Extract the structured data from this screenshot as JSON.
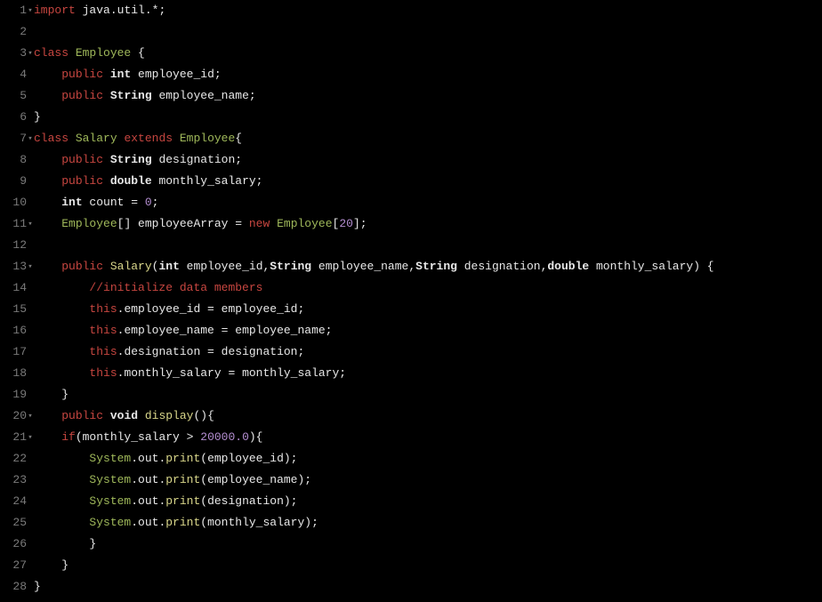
{
  "lines": [
    {
      "num": "1",
      "fold": true,
      "tokens": [
        {
          "t": "import",
          "c": "kw-red"
        },
        {
          "t": " "
        },
        {
          "t": "java",
          "c": "ident"
        },
        {
          "t": "."
        },
        {
          "t": "util",
          "c": "ident"
        },
        {
          "t": ".*;"
        }
      ]
    },
    {
      "num": "2",
      "fold": false,
      "tokens": []
    },
    {
      "num": "3",
      "fold": true,
      "tokens": [
        {
          "t": "class",
          "c": "kw-red"
        },
        {
          "t": " "
        },
        {
          "t": "Employee",
          "c": "class-name"
        },
        {
          "t": " {"
        }
      ]
    },
    {
      "num": "4",
      "fold": false,
      "tokens": [
        {
          "t": "    "
        },
        {
          "t": "public",
          "c": "kw-red"
        },
        {
          "t": " "
        },
        {
          "t": "int",
          "c": "kw-type"
        },
        {
          "t": " employee_id;"
        }
      ]
    },
    {
      "num": "5",
      "fold": false,
      "tokens": [
        {
          "t": "    "
        },
        {
          "t": "public",
          "c": "kw-red"
        },
        {
          "t": " "
        },
        {
          "t": "String",
          "c": "kw-type"
        },
        {
          "t": " employee_name;"
        }
      ]
    },
    {
      "num": "6",
      "fold": false,
      "tokens": [
        {
          "t": "}"
        }
      ]
    },
    {
      "num": "7",
      "fold": true,
      "tokens": [
        {
          "t": "class",
          "c": "kw-red"
        },
        {
          "t": " "
        },
        {
          "t": "Salary",
          "c": "class-name"
        },
        {
          "t": " "
        },
        {
          "t": "extends",
          "c": "kw-red"
        },
        {
          "t": " "
        },
        {
          "t": "Employee",
          "c": "class-name"
        },
        {
          "t": "{"
        }
      ]
    },
    {
      "num": "8",
      "fold": false,
      "tokens": [
        {
          "t": "    "
        },
        {
          "t": "public",
          "c": "kw-red"
        },
        {
          "t": " "
        },
        {
          "t": "String",
          "c": "kw-type"
        },
        {
          "t": " designation;"
        }
      ]
    },
    {
      "num": "9",
      "fold": false,
      "tokens": [
        {
          "t": "    "
        },
        {
          "t": "public",
          "c": "kw-red"
        },
        {
          "t": " "
        },
        {
          "t": "double",
          "c": "kw-type"
        },
        {
          "t": " monthly_salary;"
        }
      ]
    },
    {
      "num": "10",
      "fold": false,
      "tokens": [
        {
          "t": "    "
        },
        {
          "t": "int",
          "c": "kw-type"
        },
        {
          "t": " count = "
        },
        {
          "t": "0",
          "c": "num"
        },
        {
          "t": ";"
        }
      ]
    },
    {
      "num": "11",
      "fold": true,
      "tokens": [
        {
          "t": "    "
        },
        {
          "t": "Employee",
          "c": "class-name"
        },
        {
          "t": "[] employeeArray = "
        },
        {
          "t": "new",
          "c": "new-kw"
        },
        {
          "t": " "
        },
        {
          "t": "Employee",
          "c": "class-name"
        },
        {
          "t": "["
        },
        {
          "t": "20",
          "c": "num"
        },
        {
          "t": "];"
        }
      ]
    },
    {
      "num": "12",
      "fold": false,
      "tokens": []
    },
    {
      "num": "13",
      "fold": true,
      "tokens": [
        {
          "t": "    "
        },
        {
          "t": "public",
          "c": "kw-red"
        },
        {
          "t": " "
        },
        {
          "t": "Salary",
          "c": "method-name"
        },
        {
          "t": "("
        },
        {
          "t": "int",
          "c": "kw-type"
        },
        {
          "t": " employee_id,"
        },
        {
          "t": "String",
          "c": "kw-type"
        },
        {
          "t": " employee_name,"
        },
        {
          "t": "String",
          "c": "kw-type"
        },
        {
          "t": " designation,"
        },
        {
          "t": "double",
          "c": "kw-type"
        },
        {
          "t": " monthly_salary) {"
        }
      ]
    },
    {
      "num": "14",
      "fold": false,
      "tokens": [
        {
          "t": "        "
        },
        {
          "t": "//initialize data members",
          "c": "comment"
        }
      ]
    },
    {
      "num": "15",
      "fold": false,
      "tokens": [
        {
          "t": "        "
        },
        {
          "t": "this",
          "c": "this-kw"
        },
        {
          "t": ".employee_id = employee_id;"
        }
      ]
    },
    {
      "num": "16",
      "fold": false,
      "tokens": [
        {
          "t": "        "
        },
        {
          "t": "this",
          "c": "this-kw"
        },
        {
          "t": ".employee_name = employee_name;"
        }
      ]
    },
    {
      "num": "17",
      "fold": false,
      "tokens": [
        {
          "t": "        "
        },
        {
          "t": "this",
          "c": "this-kw"
        },
        {
          "t": ".designation = designation;"
        }
      ]
    },
    {
      "num": "18",
      "fold": false,
      "tokens": [
        {
          "t": "        "
        },
        {
          "t": "this",
          "c": "this-kw"
        },
        {
          "t": ".monthly_salary = monthly_salary;"
        }
      ]
    },
    {
      "num": "19",
      "fold": false,
      "tokens": [
        {
          "t": "    }"
        }
      ]
    },
    {
      "num": "20",
      "fold": true,
      "tokens": [
        {
          "t": "    "
        },
        {
          "t": "public",
          "c": "kw-red"
        },
        {
          "t": " "
        },
        {
          "t": "void",
          "c": "kw-type"
        },
        {
          "t": " "
        },
        {
          "t": "display",
          "c": "method-name"
        },
        {
          "t": "(){"
        }
      ]
    },
    {
      "num": "21",
      "fold": true,
      "tokens": [
        {
          "t": "    "
        },
        {
          "t": "if",
          "c": "kw-red"
        },
        {
          "t": "(monthly_salary > "
        },
        {
          "t": "20000.0",
          "c": "num"
        },
        {
          "t": "){"
        }
      ]
    },
    {
      "num": "22",
      "fold": false,
      "tokens": [
        {
          "t": "        "
        },
        {
          "t": "System",
          "c": "class-name"
        },
        {
          "t": ".out."
        },
        {
          "t": "print",
          "c": "method-name"
        },
        {
          "t": "(employee_id);"
        }
      ]
    },
    {
      "num": "23",
      "fold": false,
      "tokens": [
        {
          "t": "        "
        },
        {
          "t": "System",
          "c": "class-name"
        },
        {
          "t": ".out."
        },
        {
          "t": "print",
          "c": "method-name"
        },
        {
          "t": "(employee_name);"
        }
      ]
    },
    {
      "num": "24",
      "fold": false,
      "tokens": [
        {
          "t": "        "
        },
        {
          "t": "System",
          "c": "class-name"
        },
        {
          "t": ".out."
        },
        {
          "t": "print",
          "c": "method-name"
        },
        {
          "t": "(designation);"
        }
      ]
    },
    {
      "num": "25",
      "fold": false,
      "tokens": [
        {
          "t": "        "
        },
        {
          "t": "System",
          "c": "class-name"
        },
        {
          "t": ".out."
        },
        {
          "t": "print",
          "c": "method-name"
        },
        {
          "t": "(monthly_salary);"
        }
      ]
    },
    {
      "num": "26",
      "fold": false,
      "tokens": [
        {
          "t": "        }"
        }
      ]
    },
    {
      "num": "27",
      "fold": false,
      "tokens": [
        {
          "t": "    }"
        }
      ]
    },
    {
      "num": "28",
      "fold": false,
      "tokens": [
        {
          "t": "}"
        }
      ]
    }
  ]
}
